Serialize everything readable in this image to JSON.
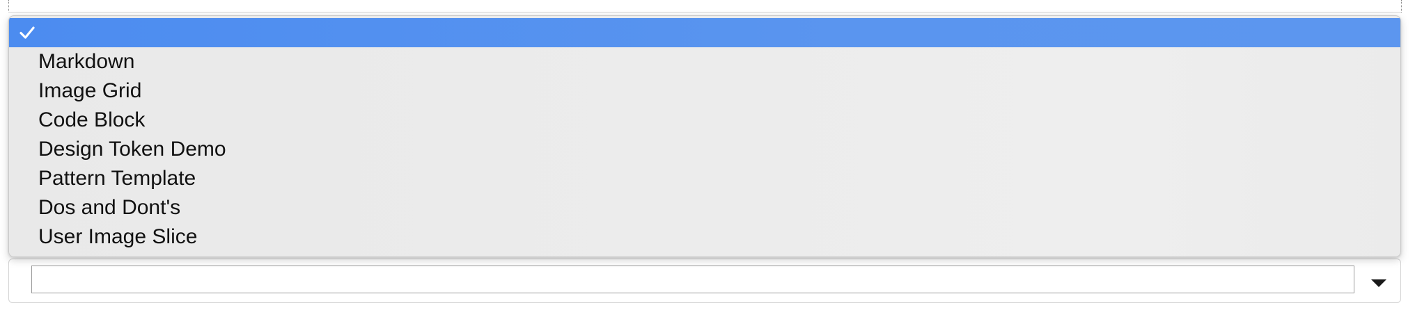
{
  "dropdown": {
    "selected_index": 0,
    "selected_color": "#4f8ef0",
    "items": [
      {
        "label": "",
        "selected": true
      },
      {
        "label": "Markdown",
        "selected": false
      },
      {
        "label": "Image Grid",
        "selected": false
      },
      {
        "label": "Code Block",
        "selected": false
      },
      {
        "label": "Design Token Demo",
        "selected": false
      },
      {
        "label": "Pattern Template",
        "selected": false
      },
      {
        "label": "Dos and Dont's",
        "selected": false
      },
      {
        "label": "User Image Slice",
        "selected": false
      }
    ]
  },
  "select": {
    "value": "",
    "caret_icon": "caret-down-icon"
  }
}
